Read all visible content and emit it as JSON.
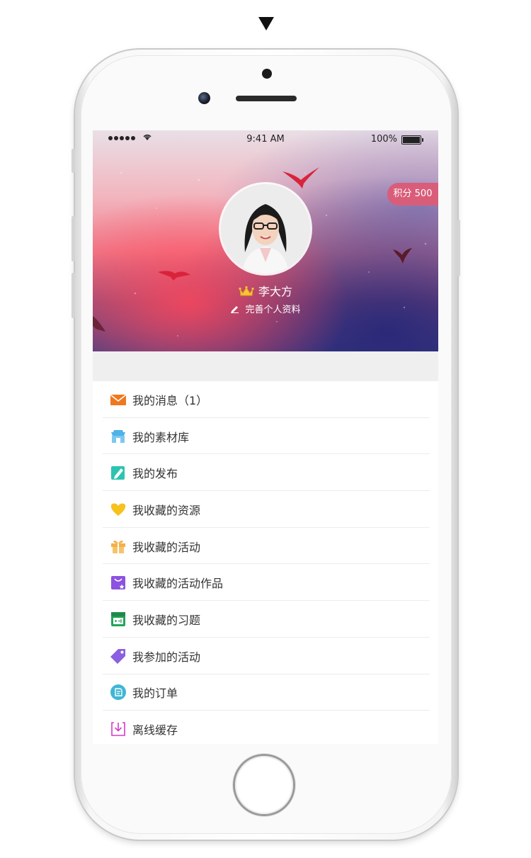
{
  "status_bar": {
    "time": "9:41 AM",
    "battery": "100%"
  },
  "profile": {
    "points": "积分 500",
    "username": "李大方",
    "edit_label": "完善个人资料"
  },
  "menu": [
    {
      "label": "我的消息（1）",
      "icon": "envelope-icon",
      "color": "#f0781e"
    },
    {
      "label": "我的素材库",
      "icon": "store-icon",
      "color": "#4fb3e8"
    },
    {
      "label": "我的发布",
      "icon": "pencil-icon",
      "color": "#2bc4b0"
    },
    {
      "label": "我收藏的资源",
      "icon": "heart-icon",
      "color": "#f7c21c"
    },
    {
      "label": "我收藏的活动",
      "icon": "gift-icon",
      "color": "#f4b048"
    },
    {
      "label": "我收藏的活动作品",
      "icon": "bag-star-icon",
      "color": "#8c52e0"
    },
    {
      "label": "我收藏的习题",
      "icon": "calculator-icon",
      "color": "#25a35a"
    },
    {
      "label": "我参加的活动",
      "icon": "tag-icon",
      "color": "#8a60e0"
    },
    {
      "label": "我的订单",
      "icon": "order-icon",
      "color": "#3fb6d6"
    },
    {
      "label": "离线缓存",
      "icon": "download-icon",
      "color": "#d23cc7"
    }
  ]
}
